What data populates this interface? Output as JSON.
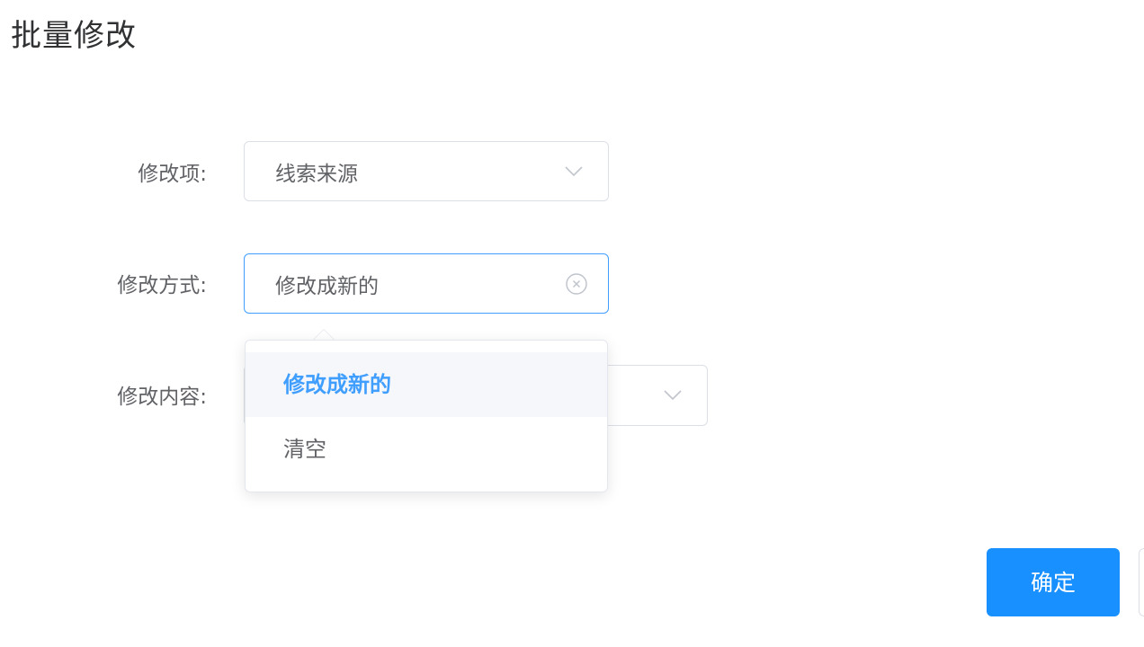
{
  "dialog": {
    "title": "批量修改"
  },
  "form": {
    "modify_item": {
      "label": "修改项:",
      "value": "线索来源",
      "icon": "chevron-down-icon"
    },
    "modify_mode": {
      "label": "修改方式:",
      "value": "修改成新的",
      "icon": "clear-icon"
    },
    "modify_content": {
      "label": "修改内容:",
      "value": "",
      "icon": "chevron-down-icon"
    }
  },
  "dropdown": {
    "options": [
      {
        "label": "修改成新的",
        "selected": true
      },
      {
        "label": "清空",
        "selected": false
      }
    ]
  },
  "footer": {
    "confirm_label": "确定"
  },
  "colors": {
    "accent": "#409eff",
    "primary_button": "#1890ff",
    "border": "#dcdfe6",
    "text": "#606266",
    "title": "#303133"
  }
}
